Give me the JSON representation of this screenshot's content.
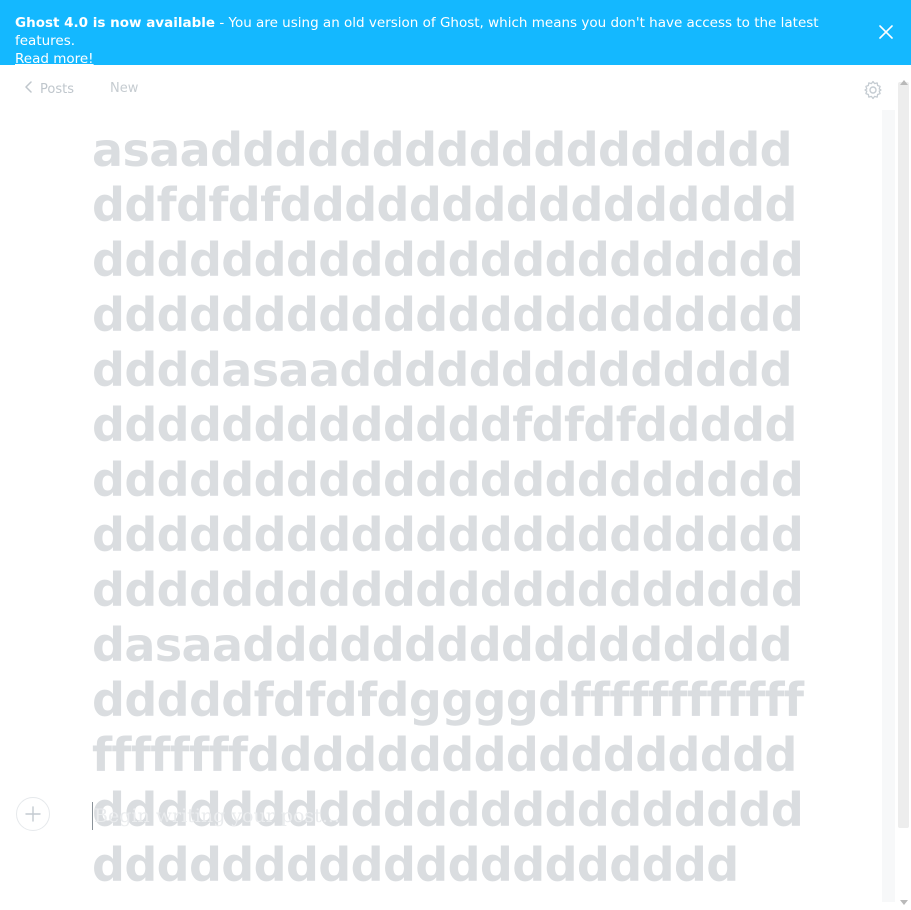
{
  "banner": {
    "strong": "Ghost 4.0 is now available",
    "message": " - You are using an old version of Ghost, which means you don't have access to the latest features.",
    "link": "Read more!"
  },
  "topbar": {
    "back_label": "Posts",
    "status": "New"
  },
  "post": {
    "title": "asaaddddddddddddddddddddfdfdfddddddddddddddddddddddddddddddddddddddddddddddddddddddddddddddddasaadddddddddddddddddddddddddddfdfdfddddddddddddddddddddddddddddddddddddddddddddddddddddddddddddddddddddddddasaaddddddddddddddddddddddfdfdfdggggdffffffffffffffffffffddddddddddddddddddddddddddddddddddddddddddddddddddddddddddd",
    "body_placeholder": "Begin writing your post..."
  },
  "colors": {
    "banner_bg": "#14b8ff",
    "title_text": "#dadde0"
  },
  "icons": {
    "back": "chevron-left-icon",
    "settings": "gear-icon",
    "close": "close-icon",
    "plus": "plus-icon"
  }
}
